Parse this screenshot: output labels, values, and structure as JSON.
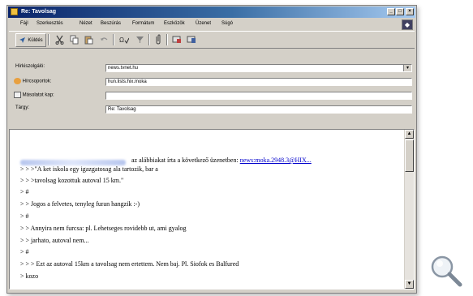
{
  "window": {
    "title": "Re: Tavolsag"
  },
  "menu": [
    "Fájl",
    "Szerkesztés",
    "Nézet",
    "Beszúrás",
    "Formátum",
    "Eszközök",
    "Üzenet",
    "Súgó"
  ],
  "toolbar": {
    "send_label": "Küldés"
  },
  "headers": {
    "server_label": "Hírkiszolgáló:",
    "server_value": "news.tvnet.hu",
    "groups_label": "Hírcsoportok:",
    "groups_value": "hun.lists.hix.moka",
    "cc_label": "Másolatot kap:",
    "cc_value": "",
    "subject_label": "Tárgy:",
    "subject_value": "Re: Tavolsag"
  },
  "body": {
    "intro_text": "az alábbiakat írta a következő üzenetben:",
    "intro_link": "news:moka.2948.3@HIX...",
    "lines": [
      "> > >\"A ket iskola egy igazgatosag ala tartozik, bar a",
      "> > >tavolsag kozottuk autoval 15 km.\"",
      "> #",
      "> > Jogos a felvetes, tenyleg furan hangzik :-)",
      "> #",
      "> > Annyira nem furcsa: pl. Lehetseges rovidebb ut, ami gyalog",
      "> > jarhato, autoval nem...",
      "> #",
      "> > > Ezt az autoval 15km a tavolsag nem ertettem. Nem baj. Pl. Siofok es Balfured",
      "> kozo"
    ]
  },
  "colors": {
    "title_start": "#0a246a",
    "title_end": "#a6caf0",
    "link": "#0000cc",
    "chrome": "#d4d0c8"
  },
  "icons": [
    "app-icon",
    "send-icon",
    "cut-icon",
    "copy-icon",
    "paste-icon",
    "undo-icon",
    "check-names-icon",
    "spelling-icon",
    "attach-icon",
    "sign-icon",
    "encrypt-icon",
    "magnifier-icon"
  ]
}
